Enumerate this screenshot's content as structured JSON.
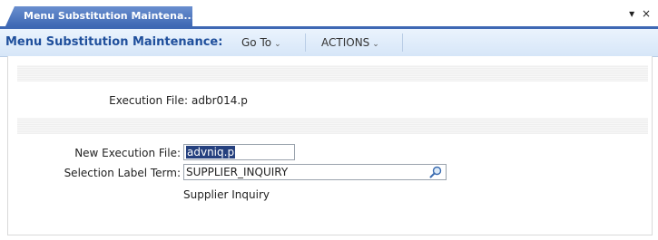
{
  "tab": {
    "label": "Menu Substitution Maintena..."
  },
  "tab_controls": {
    "dropdown": "▾",
    "close": "×"
  },
  "menubar": {
    "title": "Menu Substitution Maintenance:",
    "goto_label": "Go To",
    "actions_label": "ACTIONS",
    "caret": "⌄"
  },
  "form": {
    "execution_file_label": "Execution File:",
    "execution_file_value": "adbr014.p",
    "new_execution_file_label": "New Execution File:",
    "new_execution_file_value": "advniq.p",
    "selection_label_term_label": "Selection Label Term:",
    "selection_label_term_value": "SUPPLIER_INQUIRY",
    "selection_label_term_description": "Supplier Inquiry"
  }
}
